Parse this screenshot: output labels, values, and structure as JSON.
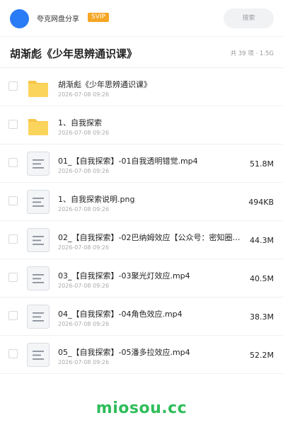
{
  "topbar": {
    "share_title": "夸克网盘分享",
    "badge": "SVIP",
    "search_label": "搜索"
  },
  "header": {
    "title": "胡渐彪《少年思辨通识课》",
    "meta": "共 39 项 · 1.5G"
  },
  "files": [
    {
      "type": "folder",
      "name": "胡渐彪《少年思辨通识课》",
      "date": "2026-07-08 09:26",
      "size": ""
    },
    {
      "type": "folder",
      "name": "1、自我探索",
      "date": "2026-07-08 09:26",
      "size": ""
    },
    {
      "type": "file",
      "name": "01_【自我探索】-01自我透明错觉.mp4",
      "date": "2026-07-08 09:26",
      "size": "51.8M"
    },
    {
      "type": "file",
      "name": "1、自我探索说明.png",
      "date": "2026-07-08 09:26",
      "size": "494KB"
    },
    {
      "type": "file",
      "name": "02_【自我探索】-02巴纳姆效应【公众号：密知圈…",
      "date": "2026-07-08 09:26",
      "size": "44.3M"
    },
    {
      "type": "file",
      "name": "03_【自我探索】-03聚光灯效应.mp4",
      "date": "2026-07-08 09:26",
      "size": "40.5M"
    },
    {
      "type": "file",
      "name": "04_【自我探索】-04角色效应.mp4",
      "date": "2026-07-08 09:26",
      "size": "38.3M"
    },
    {
      "type": "file",
      "name": "05_【自我探索】-05潘多拉效应.mp4",
      "date": "2026-07-08 09:26",
      "size": "52.2M"
    }
  ],
  "footer": {
    "watermark": "miosou.cc"
  },
  "colors": {
    "avatar": "#2a7bf6",
    "svip_badge": "#f5a623",
    "folder": "#f7c64a",
    "watermark": "#2ebd59"
  }
}
